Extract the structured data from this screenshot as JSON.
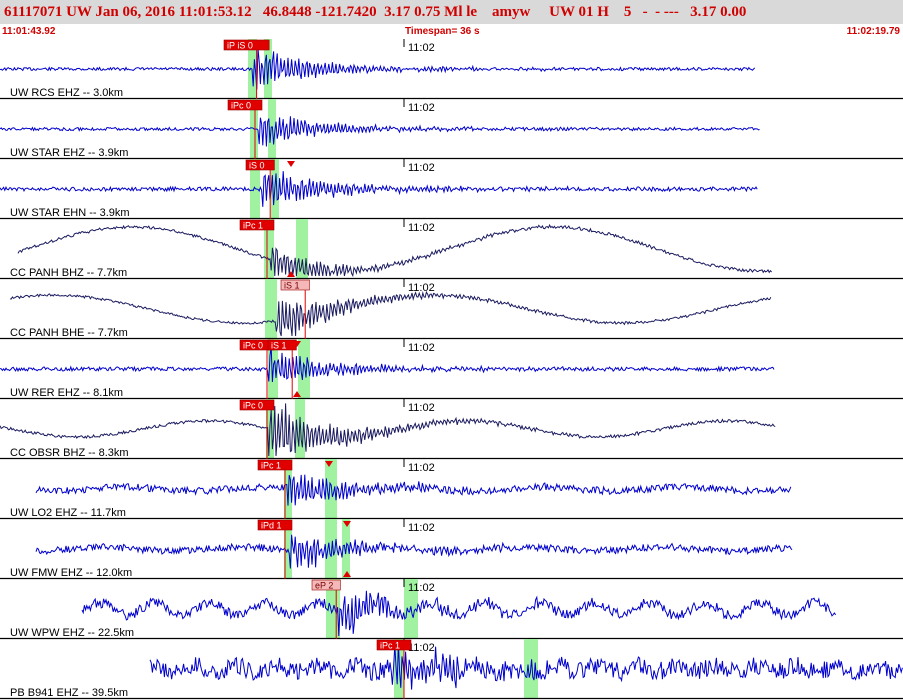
{
  "header": {
    "line": "61117071 UW Jan 06, 2016 11:01:53.12   46.8448 -121.7420  3.17 0.75 Ml le    amyw     UW 01 H    5   -  - ---   3.17 0.00"
  },
  "time_bar": {
    "start": "11:01:43.92",
    "timespan": "Timespan=  36 s",
    "end": "11:02:19.79"
  },
  "minute_label": "11:02",
  "colors": {
    "header_text": "#d00000",
    "header_bg": "#d9d9d9",
    "trace_blue": "#0000cc",
    "trace_navy": "#1a1a60",
    "pick_red": "#e00000",
    "pick_pink": "#f4b8b8",
    "window_green": "#8ff08f"
  },
  "panels": [
    {
      "label": "UW RCS EHZ -- 3.0km",
      "color": "blue",
      "picks": [
        {
          "text": "iP iS 0",
          "style": "red"
        }
      ]
    },
    {
      "label": "UW STAR EHZ -- 3.9km",
      "color": "blue",
      "picks": [
        {
          "text": "iPc 0",
          "style": "red"
        }
      ]
    },
    {
      "label": "UW STAR EHN -- 3.9km",
      "color": "blue",
      "picks": [
        {
          "text": "iS 0",
          "style": "red"
        }
      ]
    },
    {
      "label": "CC PANH BHZ -- 7.7km",
      "color": "navy",
      "picks": [
        {
          "text": "iPc 1",
          "style": "red"
        }
      ]
    },
    {
      "label": "CC PANH BHE -- 7.7km",
      "color": "navy",
      "picks": [
        {
          "text": "iS 1",
          "style": "pink"
        }
      ]
    },
    {
      "label": "UW RER EHZ -- 8.1km",
      "color": "blue",
      "picks": [
        {
          "text": "iPc 0",
          "style": "red"
        },
        {
          "text": "iS 1",
          "style": "red"
        }
      ]
    },
    {
      "label": "CC OBSR BHZ -- 8.3km",
      "color": "navy",
      "picks": [
        {
          "text": "iPc 0",
          "style": "red"
        }
      ]
    },
    {
      "label": "UW LO2 EHZ -- 11.7km",
      "color": "blue",
      "picks": [
        {
          "text": "iPc 1",
          "style": "red"
        }
      ]
    },
    {
      "label": "UW FMW EHZ -- 12.0km",
      "color": "blue",
      "picks": [
        {
          "text": "iPd 1",
          "style": "red"
        }
      ]
    },
    {
      "label": "UW WPW EHZ -- 22.5km",
      "color": "blue",
      "picks": [
        {
          "text": "eP 2",
          "style": "pink"
        }
      ]
    },
    {
      "label": "PB B941 EHZ -- 39.5km",
      "color": "blue",
      "picks": [
        {
          "text": "iPc 1",
          "style": "red"
        }
      ]
    }
  ]
}
